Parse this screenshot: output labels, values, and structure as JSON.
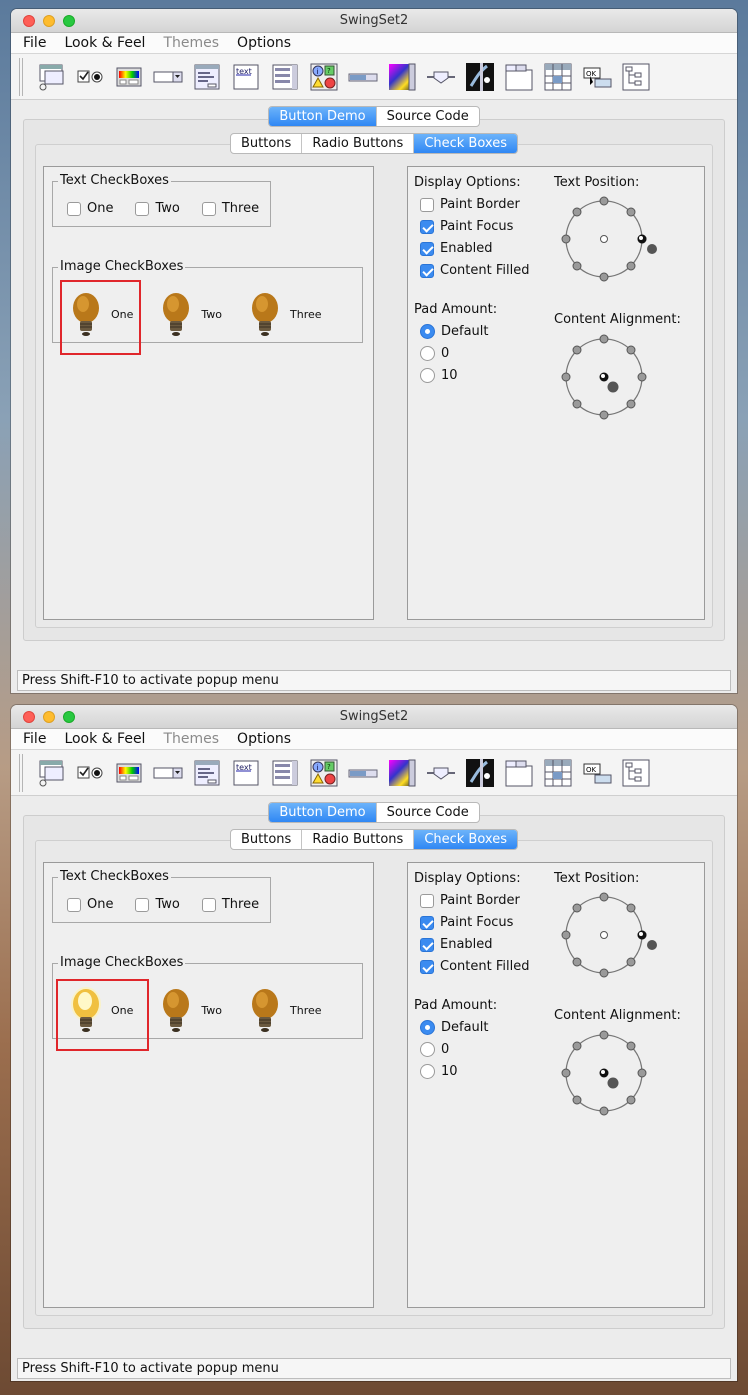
{
  "window": {
    "title": "SwingSet2"
  },
  "menu": [
    {
      "label": "File",
      "enabled": true
    },
    {
      "label": "Look & Feel",
      "enabled": true
    },
    {
      "label": "Themes",
      "enabled": false
    },
    {
      "label": "Options",
      "enabled": true
    }
  ],
  "toolbar_icons": [
    "internal-frame-icon",
    "button-icon",
    "color-chooser-icon",
    "combobox-icon",
    "file-chooser-icon",
    "html-icon",
    "list-icon",
    "option-pane-icon",
    "progress-bar-icon",
    "scroll-pane-icon",
    "slider-icon",
    "split-pane-icon",
    "tabbed-pane-icon",
    "table-icon",
    "tooltip-icon",
    "tree-icon"
  ],
  "demo_tabs": [
    {
      "label": "Button Demo",
      "selected": true
    },
    {
      "label": "Source Code",
      "selected": false
    }
  ],
  "sub_tabs": [
    {
      "label": "Buttons",
      "selected": false
    },
    {
      "label": "Radio Buttons",
      "selected": false
    },
    {
      "label": "Check Boxes",
      "selected": true
    }
  ],
  "text_checkboxes": {
    "title": "Text CheckBoxes",
    "items": [
      "One",
      "Two",
      "Three"
    ]
  },
  "image_checkboxes": {
    "title": "Image CheckBoxes",
    "items": [
      "One",
      "Two",
      "Three"
    ]
  },
  "display_options": {
    "title": "Display Options:",
    "items": [
      {
        "label": "Paint Border",
        "checked": false
      },
      {
        "label": "Paint Focus",
        "checked": true
      },
      {
        "label": "Enabled",
        "checked": true
      },
      {
        "label": "Content Filled",
        "checked": true
      }
    ]
  },
  "pad_amount": {
    "title": "Pad Amount:",
    "options": [
      {
        "label": "Default",
        "selected": true
      },
      {
        "label": "0",
        "selected": false
      },
      {
        "label": "10",
        "selected": false
      }
    ]
  },
  "text_position": {
    "title": "Text Position:"
  },
  "content_alignment": {
    "title": "Content Alignment:"
  },
  "status": "Press Shift-F10 to activate popup menu",
  "screenshots": [
    {
      "image_checkbox_one_state": "unlit"
    },
    {
      "image_checkbox_one_state": "lit"
    }
  ]
}
